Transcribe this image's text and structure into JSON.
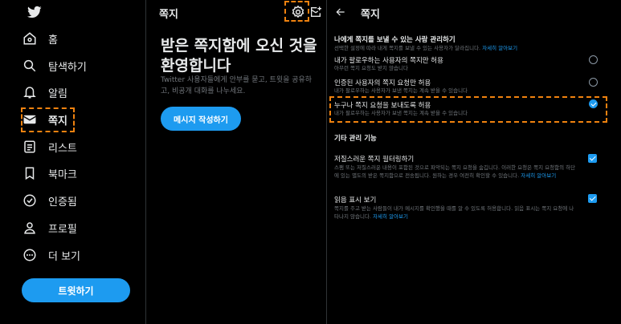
{
  "nav": {
    "items": [
      {
        "name": "home",
        "label": "홈"
      },
      {
        "name": "explore",
        "label": "탐색하기"
      },
      {
        "name": "notifications",
        "label": "알림"
      },
      {
        "name": "messages",
        "label": "쪽지"
      },
      {
        "name": "lists",
        "label": "리스트"
      },
      {
        "name": "bookmarks",
        "label": "북마크"
      },
      {
        "name": "verified",
        "label": "인증됨"
      },
      {
        "name": "profile",
        "label": "프로필"
      },
      {
        "name": "more",
        "label": "더 보기"
      }
    ],
    "active": "messages",
    "tweet_button": "트윗하기"
  },
  "messages": {
    "title": "쪽지",
    "welcome_title": "받은 쪽지함에 오신 것을 환영합니다",
    "welcome_desc": "Twitter 사용자들에게 안부를 묻고, 트윗을 공유하고, 비공개 대화를 나누세요.",
    "write_button": "메시지 작성하기"
  },
  "settings": {
    "title": "쪽지",
    "who_can_message": {
      "heading": "나에게 쪽지를 보낼 수 있는 사람 관리하기",
      "desc": "선택한 설정에 따라 내게 쪽지를 보낼 수 있는 사용자가 달라집니다.",
      "link": "자세히 알아보기",
      "options": [
        {
          "label": "내가 팔로우하는 사용자의 쪽지만 허용",
          "desc": "아무런 쪽지 요청도 받지 않습니다",
          "selected": false
        },
        {
          "label": "인증된 사용자의 쪽지 요청만 허용",
          "desc": "내가 팔로우하는 사용자가 보낸 쪽지는 계속 받을 수 있습니다",
          "selected": false
        },
        {
          "label": "누구나 쪽지 요청을 보내도록 허용",
          "desc": "내가 팔로우하는 사용자가 보낸 쪽지는 계속 받을 수 있습니다",
          "selected": true
        }
      ]
    },
    "other": {
      "heading": "기타 관리 기능",
      "filter": {
        "label": "저질스러운 쪽지 필터링하기",
        "desc1": "스팸 또는 저질스러운 내용이 포함된 것으로 파악되는 쪽지 요청을 숨깁니다. 이러한 요청은 쪽지 요청함의 하단",
        "desc2": "에 있는 별도의 받은 쪽지함으로 전송됩니다. 원하는 경우 여전히 확인할 수 있습니다.",
        "link": "자세히 알아보기",
        "checked": true
      },
      "read_receipts": {
        "label": "읽음 표시 보기",
        "desc1": "쪽지를 주고 받는 사람들이 내가 메시지를 확인했을 때를 알 수 있도록 허용합니다. 읽음 표시는 쪽지 요청에 나",
        "desc2": "타나지 않습니다.",
        "link": "자세히 알아보기",
        "checked": true
      }
    }
  },
  "colors": {
    "accent": "#1d9bf0",
    "highlight": "#f0820f",
    "background": "#000000",
    "border": "#2f3336",
    "muted": "#71767b"
  }
}
